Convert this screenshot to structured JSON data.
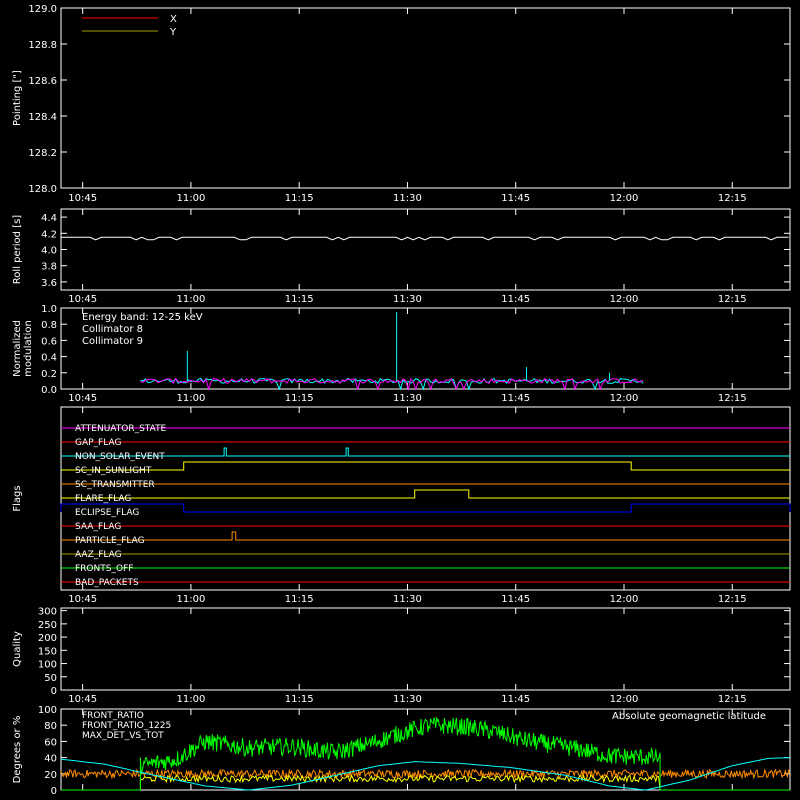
{
  "time_ticks": [
    "10:45",
    "11:00",
    "11:15",
    "11:30",
    "11:45",
    "12:00",
    "12:15"
  ],
  "time_tick_minutes": [
    -75,
    -60,
    -45,
    -30,
    -15,
    0,
    15
  ],
  "time_range_minutes": [
    -78,
    23
  ],
  "colors": {
    "red": "#ff0000",
    "olive": "#a0a000",
    "cyan": "#00ffff",
    "magenta": "#ff00ff",
    "orange": "#ff8c00",
    "yellow": "#ffff00",
    "blue": "#0000ff",
    "green": "#00ff00",
    "gray": "#808080",
    "white": "#ffffff"
  },
  "chart_data": [
    {
      "type": "line",
      "ylabel": "Pointing [\"]",
      "ylim": [
        128.0,
        129.0
      ],
      "yticks": [
        "128.0",
        "128.2",
        "128.4",
        "128.6",
        "128.8",
        "129.0"
      ],
      "yvals": [
        128.0,
        128.2,
        128.4,
        128.6,
        128.8,
        129.0
      ],
      "legend": [
        {
          "name": "X",
          "color": "#ff0000"
        },
        {
          "name": "Y",
          "color": "#a0a000"
        }
      ],
      "series": [
        {
          "name": "X",
          "values": []
        },
        {
          "name": "Y",
          "values": []
        }
      ]
    },
    {
      "type": "line",
      "ylabel": "Roll period [s]",
      "ylim": [
        3.5,
        4.5
      ],
      "yticks": [
        "3.6",
        "3.8",
        "4.0",
        "4.2",
        "4.4"
      ],
      "yvals": [
        3.6,
        3.8,
        4.0,
        4.2,
        4.4
      ],
      "series": [
        {
          "name": "Roll period",
          "level": 4.15,
          "x_range": [
            -78,
            23
          ]
        }
      ]
    },
    {
      "type": "line",
      "ylabel": [
        "Normalized",
        "modulation"
      ],
      "ylim": [
        0,
        1.0
      ],
      "yticks": [
        "0.0",
        "0.2",
        "0.4",
        "0.6",
        "0.8",
        "1.0"
      ],
      "yvals": [
        0,
        0.2,
        0.4,
        0.6,
        0.8,
        1.0
      ],
      "legend": [
        {
          "name": "Energy band: 12-25 keV",
          "color": "#ffffff"
        },
        {
          "name": "Collimator 8",
          "color": "#00ffff"
        },
        {
          "name": "Collimator 9",
          "color": "#ff00ff"
        }
      ],
      "x_range": [
        -67,
        3
      ],
      "baseline": 0.1,
      "spikes": [
        {
          "x": -60.5,
          "y": 0.47
        },
        {
          "x": -31.5,
          "y": 0.95
        },
        {
          "x": -13.5,
          "y": 0.27
        },
        {
          "x": -2,
          "y": 0.2
        }
      ]
    },
    {
      "type": "table",
      "ylabel": "Flags",
      "flags": [
        {
          "name": "ATTENUATOR_STATE",
          "color": "#ff00ff",
          "pulses": []
        },
        {
          "name": "GAP_FLAG",
          "color": "#ff0000",
          "pulses": []
        },
        {
          "name": "NON_SOLAR_EVENT",
          "color": "#00ffff",
          "pulses": [
            [
              -55.4,
              -55.1
            ],
            [
              -38.5,
              -38.2
            ]
          ]
        },
        {
          "name": "SC_IN_SUNLIGHT",
          "color": "#ffff00",
          "pulses": [
            [
              -61,
              1
            ]
          ]
        },
        {
          "name": "SC_TRANSMITTER",
          "color": "#ff8c00",
          "pulses": []
        },
        {
          "name": "FLARE_FLAG",
          "color": "#ffff00",
          "pulses": [
            [
              -29,
              -21.5
            ]
          ]
        },
        {
          "name": "ECLIPSE_FLAG",
          "color": "#0000ff",
          "pulses": [
            [
              -78,
              -61
            ],
            [
              1,
              23
            ]
          ]
        },
        {
          "name": "SAA_FLAG",
          "color": "#ff0000",
          "pulses": []
        },
        {
          "name": "PARTICLE_FLAG",
          "color": "#ff8c00",
          "pulses": [
            [
              -54.3,
              -53.8
            ]
          ]
        },
        {
          "name": "AAZ_FLAG",
          "color": "#a0a000",
          "pulses": []
        },
        {
          "name": "FRONTS_OFF",
          "color": "#00ff00",
          "pulses": []
        },
        {
          "name": "BAD_PACKETS",
          "color": "#ff0000",
          "pulses": []
        }
      ]
    },
    {
      "type": "line",
      "ylabel": "Quality",
      "ylim": [
        0,
        310
      ],
      "yticks": [
        "0",
        "50",
        "100",
        "150",
        "200",
        "250",
        "300"
      ],
      "yvals": [
        0,
        50,
        100,
        150,
        200,
        250,
        300
      ],
      "series": [
        {
          "name": "Quality",
          "values": []
        }
      ]
    },
    {
      "type": "line",
      "ylabel": "Degrees or %",
      "ylim": [
        0,
        100
      ],
      "yticks": [
        "0",
        "20",
        "40",
        "60",
        "80",
        "100"
      ],
      "yvals": [
        0,
        20,
        40,
        60,
        80,
        100
      ],
      "legend": [
        {
          "name": "FRONT_RATIO",
          "color": "#ffff00"
        },
        {
          "name": "FRONT_RATIO_1225",
          "color": "#00ff00"
        },
        {
          "name": "MAX_DET_VS_TOT",
          "color": "#ff8c00"
        }
      ],
      "legend_right": {
        "name": "Absolute geomagnetic latitude",
        "color": "#00ffff"
      },
      "series": [
        {
          "name": "FRONT_RATIO_1225",
          "x_range": [
            -67,
            5
          ],
          "points": [
            [
              -67,
              30
            ],
            [
              -62,
              38
            ],
            [
              -58,
              60
            ],
            [
              -52,
              52
            ],
            [
              -46,
              54
            ],
            [
              -40,
              46
            ],
            [
              -35,
              58
            ],
            [
              -31,
              70
            ],
            [
              -27,
              80
            ],
            [
              -22,
              78
            ],
            [
              -18,
              72
            ],
            [
              -14,
              62
            ],
            [
              -10,
              56
            ],
            [
              -6,
              50
            ],
            [
              -2,
              42
            ],
            [
              5,
              40
            ]
          ]
        },
        {
          "name": "MAX_DET_VS_TOT",
          "x_range": [
            -78,
            23
          ],
          "level": 20
        },
        {
          "name": "FRONT_RATIO",
          "x_range": [
            -67,
            5
          ],
          "level": 14
        },
        {
          "name": "Absolute geomagnetic latitude",
          "points": [
            [
              -78,
              38
            ],
            [
              -72,
              32
            ],
            [
              -66,
              20
            ],
            [
              -58,
              5
            ],
            [
              -52,
              0
            ],
            [
              -46,
              6
            ],
            [
              -40,
              18
            ],
            [
              -34,
              30
            ],
            [
              -29,
              35
            ],
            [
              -23,
              33
            ],
            [
              -16,
              28
            ],
            [
              -8,
              18
            ],
            [
              -2,
              5
            ],
            [
              3,
              0
            ],
            [
              9,
              12
            ],
            [
              15,
              30
            ],
            [
              20,
              39
            ],
            [
              23,
              40
            ]
          ]
        }
      ]
    }
  ]
}
